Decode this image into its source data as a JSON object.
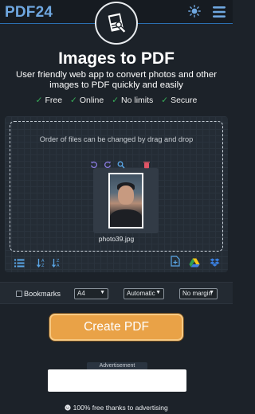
{
  "header": {
    "brand": "PDF24",
    "logo_icon": "pdf-tools-logo-icon",
    "theme_icon": "sun-icon",
    "menu_icon": "hamburger-menu-icon",
    "accent": "#6fa7e0"
  },
  "hero": {
    "title": "Images to PDF",
    "subtitle": "User friendly web app to convert photos and other images to PDF quickly and easily",
    "features": [
      {
        "check": "✓",
        "label": "Free"
      },
      {
        "check": "✓",
        "label": "Online"
      },
      {
        "check": "✓",
        "label": "No limits"
      },
      {
        "check": "✓",
        "label": "Secure"
      }
    ]
  },
  "upload": {
    "hint": "Order of files can be changed by drag and drop",
    "file": {
      "name": "photo39.jpg",
      "tools": [
        "rotate-left-icon",
        "rotate-right-icon",
        "zoom-icon",
        "delete-icon"
      ]
    },
    "toolbar_left": [
      "list-view-icon",
      "sort-az-icon",
      "sort-za-icon"
    ],
    "toolbar_right": [
      "add-file-icon",
      "google-drive-icon",
      "dropbox-icon"
    ]
  },
  "options": {
    "bookmarks_label": "Bookmarks",
    "bookmarks_checked": false,
    "page_size": "A4",
    "orientation": "Automatic",
    "margin": "No margin"
  },
  "action": {
    "create_label": "Create PDF",
    "color": "#e9a247"
  },
  "ad": {
    "label": "Advertisement"
  },
  "footer": {
    "note_icon": "smile-icon",
    "note": "100% free thanks to advertising"
  }
}
